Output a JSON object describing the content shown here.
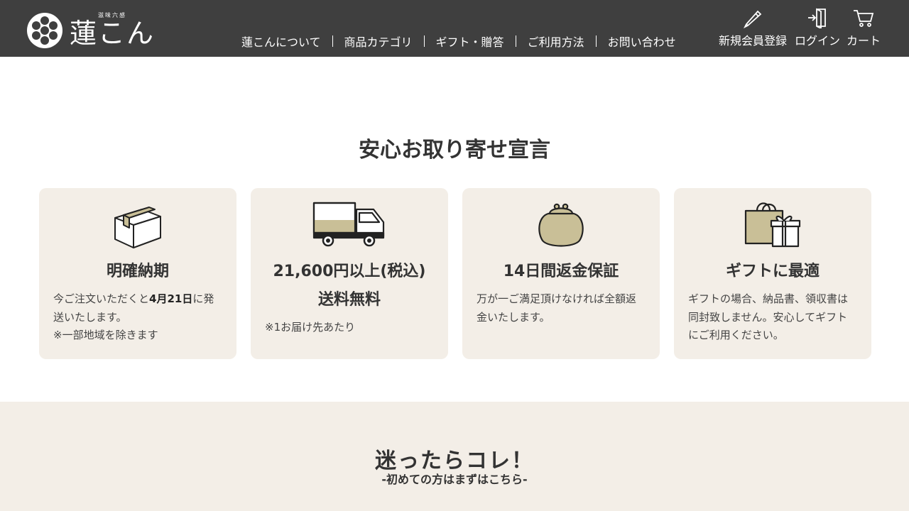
{
  "header": {
    "logo_text": "蓮こん",
    "logo_sub": "滋味六感",
    "nav": [
      "蓮こんについて",
      "商品カテゴリ",
      "ギフト・贈答",
      "ご利用方法",
      "お問い合わせ"
    ],
    "util": {
      "register": "新規会員登録",
      "login": "ログイン",
      "cart": "カート"
    }
  },
  "promise": {
    "title": "安心お取り寄せ宣言",
    "cards": [
      {
        "icon": "box-icon",
        "title": "明確納期",
        "desc_pre": "今ご注文いただくと",
        "desc_bold": "4月21日",
        "desc_post": "に発送いたします。",
        "desc_note": "※一部地域を除きます"
      },
      {
        "icon": "truck-icon",
        "title_line1": "21,600円以上(税込)",
        "title_line2": "送料無料",
        "desc": "※1お届け先あたり"
      },
      {
        "icon": "purse-icon",
        "title": "14日間返金保証",
        "desc": "万が一ご満足頂けなければ全額返金いたします。"
      },
      {
        "icon": "gift-bag-icon",
        "title": "ギフトに最適",
        "desc": "ギフトの場合、納品書、領収書は同封致しません。安心してギフトにご利用ください。"
      }
    ]
  },
  "recommend": {
    "title": "迷ったらコレ！",
    "subtitle": "-初めての方はまずはこちら-"
  },
  "colors": {
    "header_bg": "#3f3f3f",
    "card_bg": "#f3eee7",
    "icon_beige": "#c9bf97",
    "text": "#333333"
  }
}
